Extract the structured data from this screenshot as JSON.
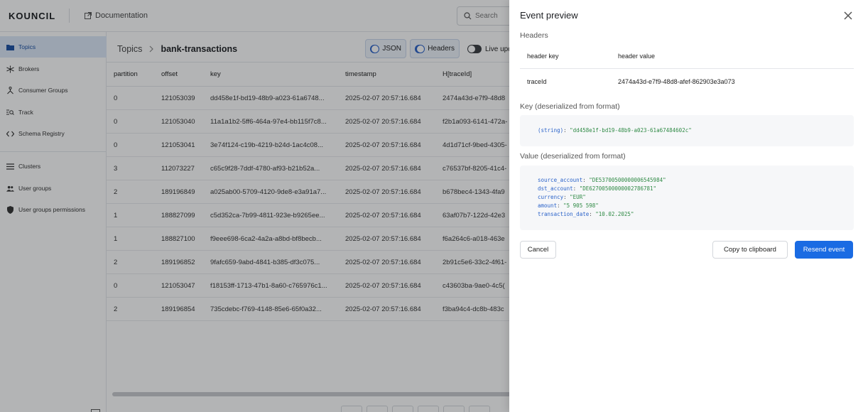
{
  "topbar": {
    "logo": "KOUNCIL",
    "documentation": "Documentation",
    "search_placeholder": "Search"
  },
  "sidebar": {
    "items": [
      {
        "label": "Topics",
        "icon": "folder-icon",
        "active": true
      },
      {
        "label": "Brokers",
        "icon": "brokers-icon",
        "active": false
      },
      {
        "label": "Consumer Groups",
        "icon": "consumer-groups-icon",
        "active": false
      },
      {
        "label": "Track",
        "icon": "track-icon",
        "active": false
      },
      {
        "label": "Schema Registry",
        "icon": "code-icon",
        "active": false
      },
      {
        "label": "Clusters",
        "icon": "list-icon",
        "active": false
      },
      {
        "label": "User groups",
        "icon": "users-icon",
        "active": false
      },
      {
        "label": "User groups permissions",
        "icon": "shield-icon",
        "active": false
      }
    ]
  },
  "main": {
    "breadcrumb": {
      "root": "Topics",
      "current": "bank-transactions"
    },
    "toggles": {
      "json": "JSON",
      "headers": "Headers",
      "live": "Live upd"
    },
    "columns": [
      "partition",
      "offset",
      "key",
      "timestamp",
      "H[traceId]"
    ],
    "rows": [
      [
        "0",
        "121053039",
        "dd458e1f-bd19-48b9-a023-61a6748...",
        "2025-02-07 20:57:16.684",
        "2474a43d-e7f9-48d8"
      ],
      [
        "0",
        "121053040",
        "11a1a1b2-5ff6-464a-97e4-bb115f7c8...",
        "2025-02-07 20:57:16.684",
        "f2b1a093-6141-472a-"
      ],
      [
        "0",
        "121053041",
        "3e74f124-c19b-4219-b24d-1ac4c08...",
        "2025-02-07 20:57:16.684",
        "4d1d71cf-9bed-4305-"
      ],
      [
        "3",
        "112073227",
        "c65c9f28-7ddf-4780-af93-b21b52a...",
        "2025-02-07 20:57:16.684",
        "c76537bf-8205-41c4-"
      ],
      [
        "2",
        "189196849",
        "a025ab00-5709-4120-9de8-e3a91a7...",
        "2025-02-07 20:57:16.684",
        "b678bec4-1343-4fa9"
      ],
      [
        "1",
        "188827099",
        "c5d352ca-7b99-4811-923e-b9265ee...",
        "2025-02-07 20:57:16.684",
        "63af07b7-122d-42e3"
      ],
      [
        "1",
        "188827100",
        "f9eee698-6ca2-4a2a-a8bd-bf8becb...",
        "2025-02-07 20:57:16.684",
        "f6a264c6-a018-463e"
      ],
      [
        "2",
        "189196852",
        "9fafc659-9abd-4841-b385-df3c075...",
        "2025-02-07 20:57:16.684",
        "2b91c5e6-33c2-4f61-"
      ],
      [
        "0",
        "121053047",
        "f18153ff-1713-47b1-8a60-c765976c1...",
        "2025-02-07 20:57:16.684",
        "c43603ba-9ae0-4c5("
      ],
      [
        "2",
        "189196854",
        "735cdebc-f769-4148-85e6-65f0a32...",
        "2025-02-07 20:57:16.684",
        "f3ba94c4-dc8b-483c"
      ]
    ]
  },
  "drawer": {
    "title": "Event preview",
    "headers_label": "Headers",
    "header_key_col": "header key",
    "header_value_col": "header value",
    "header_rows": [
      {
        "key": "traceId",
        "value": "2474a43d-e7f9-48d8-afef-862903e3a073"
      }
    ],
    "key_label": "Key (deserialized from format)",
    "key_type": "(string)",
    "key_value": "\"dd458e1f-bd19-48b9-a023-61a67484602c\"",
    "value_label": "Value (deserialized from format)",
    "value_lines": [
      {
        "k": "source_account",
        "v": "\"DE53700500000006545984\""
      },
      {
        "k": "dst_account",
        "v": "\"DE62700500000002786781\""
      },
      {
        "k": "currency",
        "v": "\"EUR\""
      },
      {
        "k": "amount",
        "v": "\"5 905 598\""
      },
      {
        "k": "transaction_date",
        "v": "\"10.02.2025\""
      }
    ],
    "cancel": "Cancel",
    "copy": "Copy to clipboard",
    "resend": "Resend event"
  },
  "colors": {
    "accent": "#1a6be3",
    "active_bg": "#dce8f8",
    "overlay": "rgba(20,22,26,0.32)"
  }
}
